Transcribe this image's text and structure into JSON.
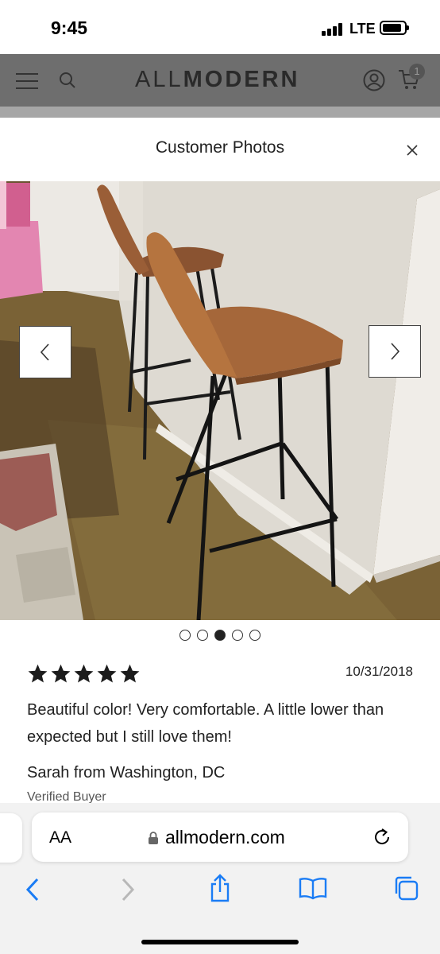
{
  "status_bar": {
    "time": "9:45",
    "network": "LTE"
  },
  "site_header": {
    "logo_light": "ALL",
    "logo_bold": "MODERN",
    "cart_count": "1"
  },
  "modal": {
    "title": "Customer Photos",
    "dots": {
      "count": 5,
      "active_index": 2
    }
  },
  "review": {
    "rating": 5,
    "date": "10/31/2018",
    "text": "Beautiful color! Very comfortable. A little lower than expected but I still love them!",
    "reviewer": "Sarah from Washington, DC",
    "badge": "Verified Buyer"
  },
  "browser": {
    "text_size_label": "AA",
    "url": "allmodern.com",
    "toolbar_icons": [
      "back-icon",
      "forward-icon",
      "share-icon",
      "bookmarks-icon",
      "tabs-icon"
    ]
  },
  "colors": {
    "accent": "#1a7cf5",
    "header_overlay": "#6e6e6e",
    "leather": "#a5673a"
  }
}
